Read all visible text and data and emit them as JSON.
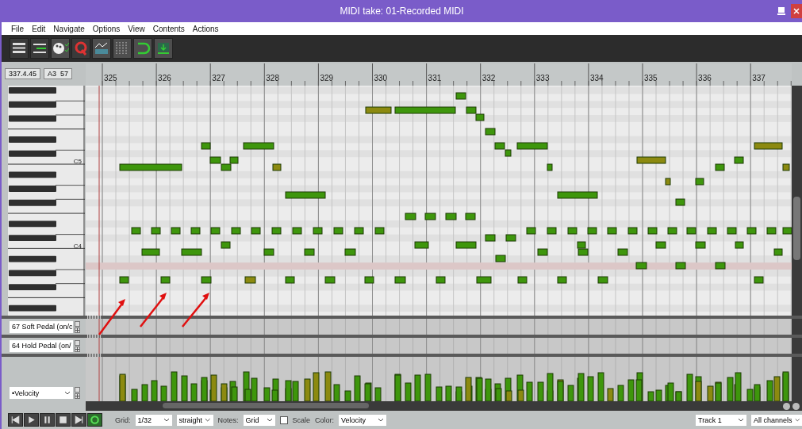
{
  "window": {
    "title": "MIDI take: 01-Recorded MIDI"
  },
  "menu": [
    "File",
    "Edit",
    "Navigate",
    "Options",
    "View",
    "Contents",
    "Actions"
  ],
  "position": {
    "time": "337.4.45",
    "note": "A3  57"
  },
  "ruler": [
    "325",
    "326",
    "327",
    "328",
    "329",
    "330",
    "331",
    "332",
    "333",
    "334",
    "335",
    "336",
    "337"
  ],
  "keyboard_labels": [
    "C5",
    "C4"
  ],
  "lanes": [
    {
      "name": "67 Soft Pedal (on/c",
      "kind": "cc"
    },
    {
      "name": "64 Hold Pedal (on/",
      "kind": "cc"
    },
    {
      "name": "•Velocity",
      "kind": "velocity"
    }
  ],
  "bottom_bar": {
    "grid_label": "Grid:",
    "grid": "1/32",
    "swing": "straight",
    "notes_label": "Notes:",
    "notes": "Grid",
    "scale": {
      "label": "Scale",
      "checked": false
    },
    "color_label": "Color:",
    "color_mode": "Velocity",
    "track": "Track 1",
    "channels": "All channels"
  }
}
